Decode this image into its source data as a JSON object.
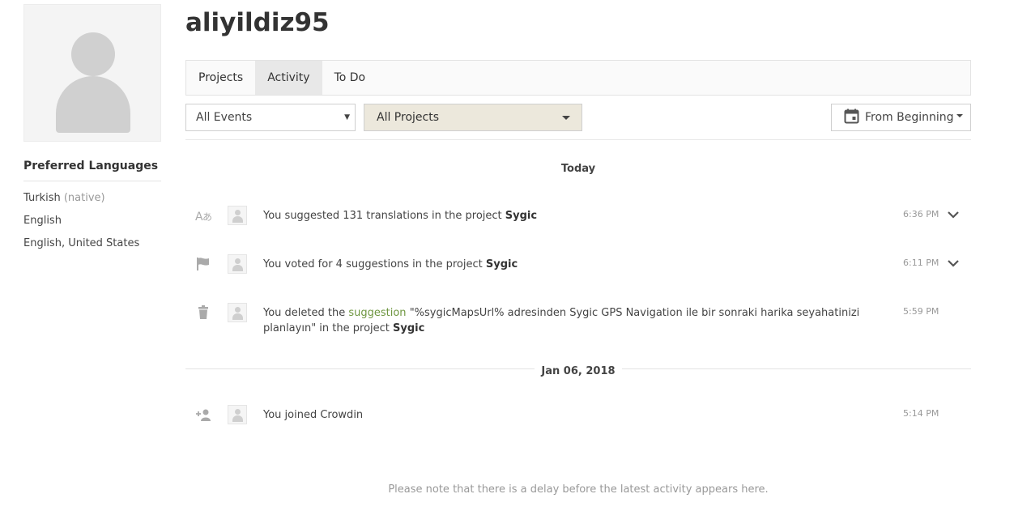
{
  "profile": {
    "username": "aliyildiz95",
    "preferred_languages_title": "Preferred Languages",
    "languages": [
      {
        "name": "Turkish",
        "note": "(native)"
      },
      {
        "name": "English",
        "note": ""
      },
      {
        "name": "English, United States",
        "note": ""
      }
    ]
  },
  "tabs": [
    {
      "label": "Projects"
    },
    {
      "label": "Activity"
    },
    {
      "label": "To Do"
    }
  ],
  "filters": {
    "events": "All Events",
    "projects": "All Projects",
    "date_range": "From Beginning"
  },
  "days": [
    {
      "label": "Today",
      "activities": [
        {
          "icon": "translate-icon",
          "text_before": "You suggested 131 translations in the project ",
          "project": "Sygic",
          "time": "6:36 PM",
          "expandable": true
        },
        {
          "icon": "flag-icon",
          "text_before": "You voted for 4 suggestions in the project ",
          "project": "Sygic",
          "time": "6:11 PM",
          "expandable": true
        },
        {
          "icon": "trash-icon",
          "text_before": "You deleted the ",
          "link": "suggestion",
          "text_middle": " \"%sygicMapsUrl% adresinden Sygic GPS Navigation ile bir sonraki harika seyahatinizi planlayın\" in the project ",
          "project": "Sygic",
          "time": "5:59 PM",
          "expandable": false
        }
      ]
    },
    {
      "label": "Jan 06, 2018",
      "activities": [
        {
          "icon": "add-user-icon",
          "text_before": "You joined Crowdin",
          "time": "5:14 PM",
          "expandable": false
        }
      ]
    }
  ],
  "note": "Please note that there is a delay before the latest activity appears here.",
  "colors": {
    "active_tab": "#e8e8e8",
    "project_filter_bg": "#ece8dc",
    "link": "#6e9640"
  }
}
